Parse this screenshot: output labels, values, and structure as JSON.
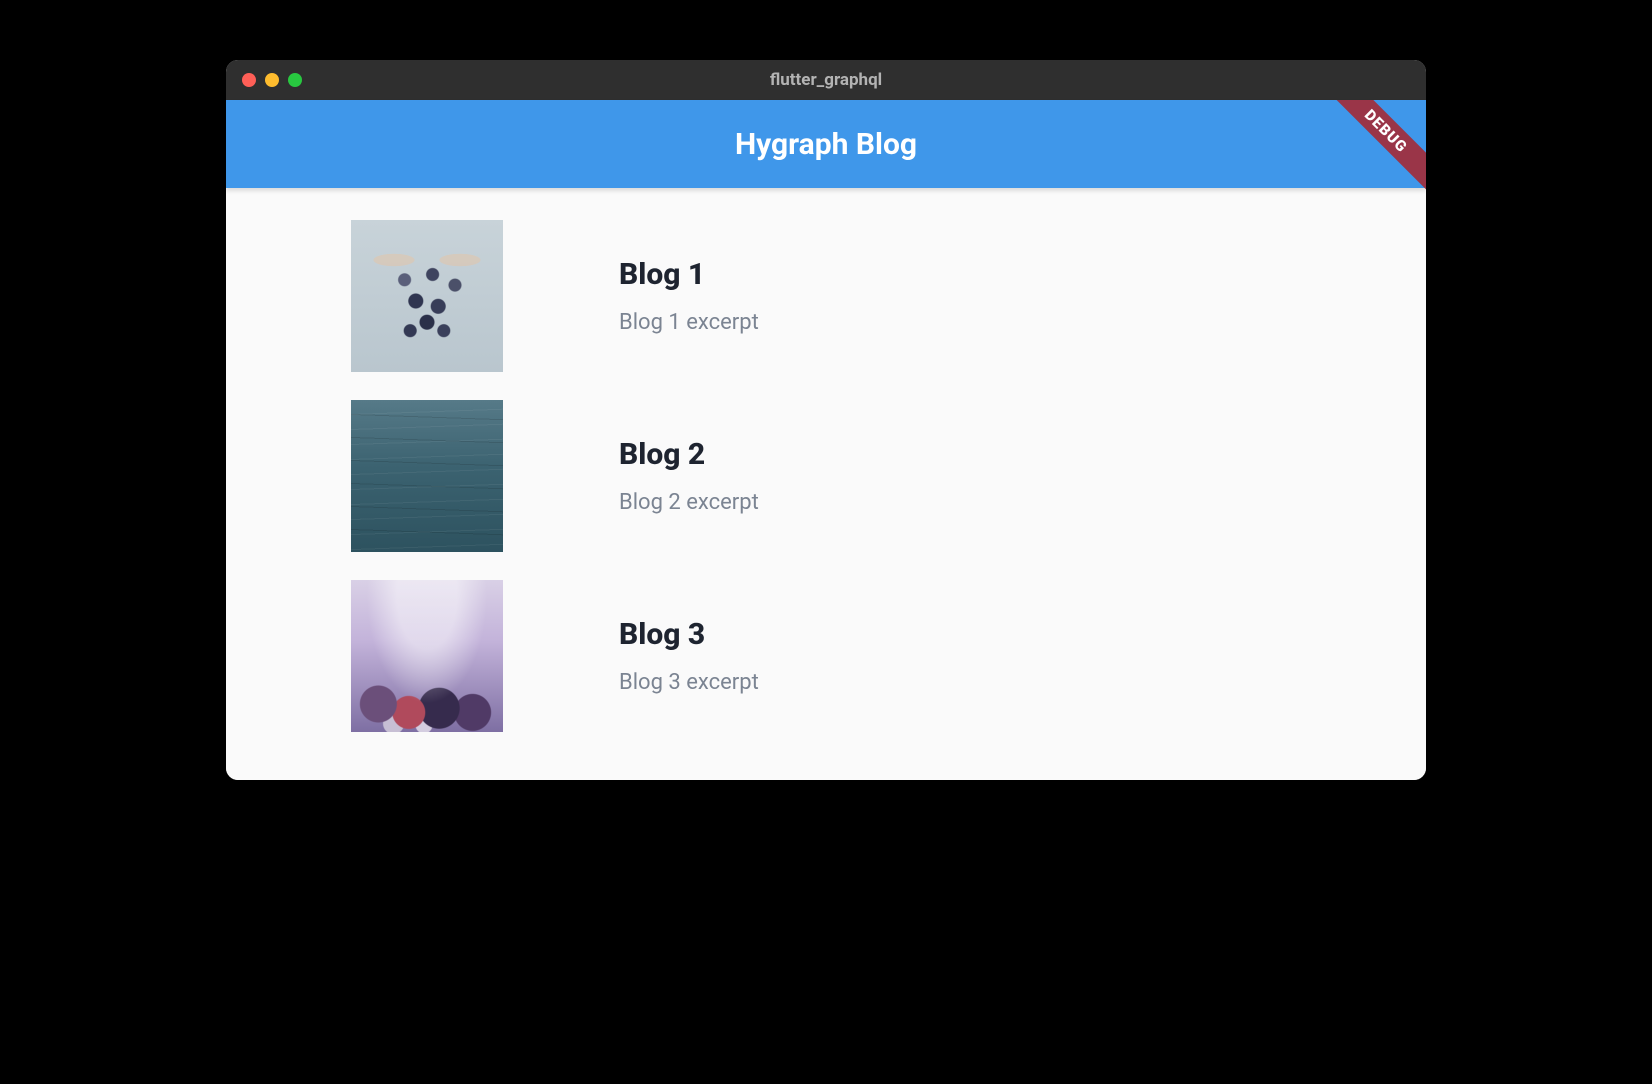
{
  "window": {
    "title": "flutter_graphql"
  },
  "appbar": {
    "title": "Hygraph Blog"
  },
  "debug_banner": "DEBUG",
  "posts": [
    {
      "title": "Blog 1",
      "excerpt": "Blog 1 excerpt",
      "image_semantic": "grapes-thumbnail"
    },
    {
      "title": "Blog 2",
      "excerpt": "Blog 2 excerpt",
      "image_semantic": "water-thumbnail"
    },
    {
      "title": "Blog 3",
      "excerpt": "Blog 3 excerpt",
      "image_semantic": "berries-thumbnail"
    }
  ]
}
